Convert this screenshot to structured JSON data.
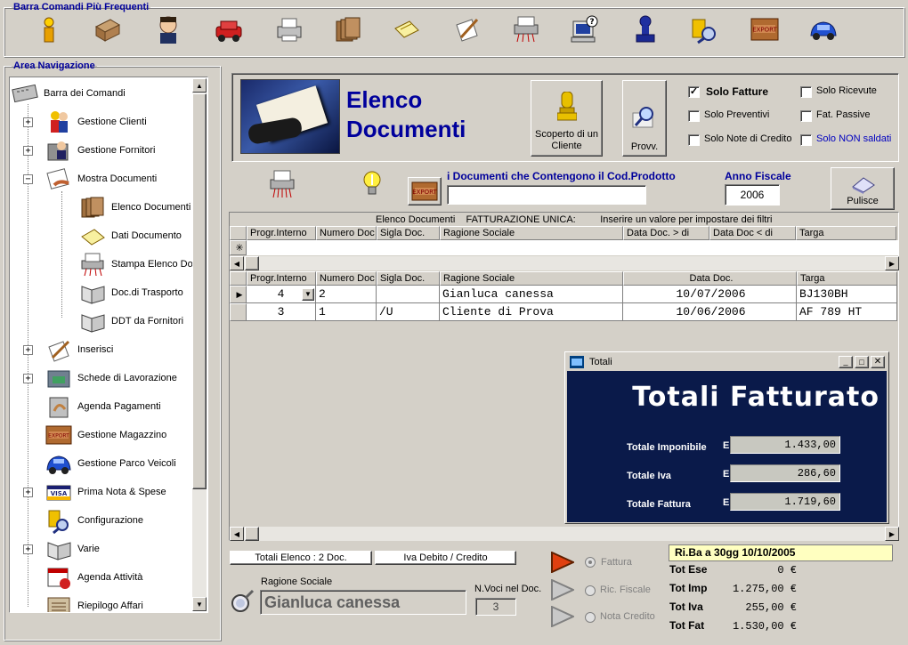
{
  "toolbar": {
    "legend": "Barra Comandi Più Frequenti",
    "icons": [
      "info-icon",
      "archive-icon",
      "client-icon",
      "car-icon",
      "printer-icon",
      "folders-icon",
      "note-icon",
      "edit-icon",
      "shredder-icon",
      "help-computer-icon",
      "stamp-icon",
      "config-icon",
      "export-icon",
      "vw-beetle-icon"
    ]
  },
  "nav": {
    "legend": "Area Navigazione",
    "items": [
      {
        "label": "Barra dei Comandi"
      },
      {
        "label": "Gestione Clienti"
      },
      {
        "label": "Gestione Fornitori"
      },
      {
        "label": "Mostra Documenti"
      },
      {
        "label": "Elenco Documenti"
      },
      {
        "label": "Dati Documento"
      },
      {
        "label": "Stampa Elenco Do"
      },
      {
        "label": "Doc.di Trasporto"
      },
      {
        "label": "DDT da Fornitori"
      },
      {
        "label": "Inserisci"
      },
      {
        "label": "Schede di Lavorazione"
      },
      {
        "label": "Agenda Pagamenti"
      },
      {
        "label": "Gestione Magazzino"
      },
      {
        "label": "Gestione Parco Veicoli"
      },
      {
        "label": "Prima Nota & Spese"
      },
      {
        "label": "Configurazione"
      },
      {
        "label": "Varie"
      },
      {
        "label": "Agenda Attività"
      },
      {
        "label": "Riepilogo Affari"
      }
    ]
  },
  "header": {
    "title_line1": "Elenco",
    "title_line2": "Documenti",
    "scoperto_label": "Scoperto di un Cliente",
    "provv_label": "Provv.",
    "filters": {
      "solo_fatture": "Solo Fatture",
      "solo_preventivi": "Solo Preventivi",
      "solo_note": "Solo Note di Credito",
      "solo_ricevute": "Solo Ricevute",
      "fat_passive": "Fat. Passive",
      "solo_non_saldati": "Solo NON saldati"
    }
  },
  "search": {
    "cod_prodotto_label": "i Documenti che Contengono il Cod.Prodotto",
    "cod_prodotto_value": "",
    "anno_label": "Anno Fiscale",
    "anno_value": "2006",
    "pulisce_label": "Pulisce"
  },
  "grid": {
    "banner": "Elenco Documenti    FATTURAZIONE UNICA:         Inserire un valore per impostare dei filtri",
    "filter_headers": [
      "Progr.Interno",
      "Numero Doc",
      "Sigla Doc.",
      "Ragione Sociale",
      "Data Doc. > di",
      "Data Doc < di",
      "Targa"
    ],
    "headers": [
      "Progr.Interno",
      "Numero Doc",
      "Sigla Doc.",
      "Ragione Sociale",
      "Data Doc.",
      "Targa"
    ],
    "rows": [
      {
        "progr": "4",
        "numero": "2",
        "sigla": "",
        "ragione": "Gianluca canessa",
        "data": "10/07/2006",
        "targa": "BJ130BH"
      },
      {
        "progr": "3",
        "numero": "1",
        "sigla": "/U",
        "ragione": "Cliente di Prova",
        "data": "10/06/2006",
        "targa": "AF 789 HT"
      }
    ]
  },
  "totali_window": {
    "title": "Totali",
    "heading": "Totali Fatturato",
    "imponibile_label": "Totale Imponibile",
    "iva_label": "Totale Iva",
    "fattura_label": "Totale Fattura",
    "currency": "E",
    "imponibile": "1.433,00",
    "iva": "286,60",
    "fattura": "1.719,60"
  },
  "footer": {
    "totali_elenco": "Totali Elenco :  2 Doc.",
    "iva_debito": "Iva Debito / Credito",
    "ragione_label": "Ragione Sociale",
    "ragione_value": "Gianluca canessa",
    "nvoci_label": "N.Voci nel Doc.",
    "nvoci_value": "3",
    "radio_fattura": "Fattura",
    "radio_ric": "Ric. Fiscale",
    "radio_nota": "Nota Credito",
    "riba": "Ri.Ba a 30gg  10/10/2005",
    "tot_ese_label": "Tot Ese",
    "tot_ese": "0 €",
    "tot_imp_label": "Tot Imp",
    "tot_imp": "1.275,00 €",
    "tot_iva_label": "Tot Iva",
    "tot_iva": "255,00 €",
    "tot_fat_label": "Tot Fat",
    "tot_fat": "1.530,00 €"
  },
  "colors": {
    "navy": "#00009c",
    "panel": "#d4d0c8",
    "window_bg": "#0a1a4a",
    "title_bar": "#0a246a",
    "highlight": "#ffffc0"
  }
}
